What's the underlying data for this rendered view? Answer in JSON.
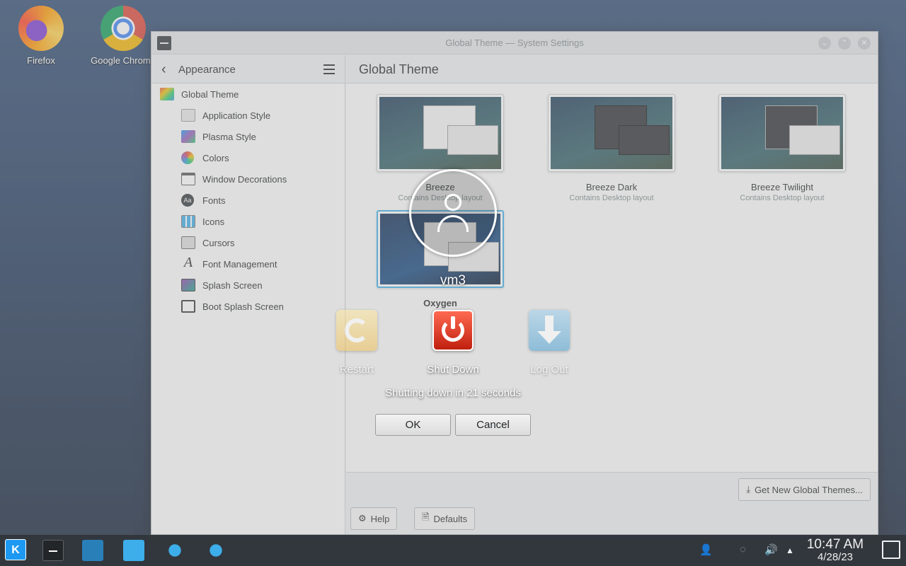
{
  "desktop": {
    "icons": [
      {
        "label": "Firefox"
      },
      {
        "label": "Google Chrome"
      }
    ]
  },
  "window": {
    "title": "Global Theme — System Settings",
    "sidebar": {
      "title": "Appearance",
      "items": [
        {
          "label": "Global Theme"
        },
        {
          "label": "Application Style"
        },
        {
          "label": "Plasma Style"
        },
        {
          "label": "Colors"
        },
        {
          "label": "Window Decorations"
        },
        {
          "label": "Fonts"
        },
        {
          "label": "Icons"
        },
        {
          "label": "Cursors"
        },
        {
          "label": "Font Management"
        },
        {
          "label": "Splash Screen"
        },
        {
          "label": "Boot Splash Screen"
        }
      ]
    },
    "main": {
      "title": "Global Theme",
      "themes": [
        {
          "name": "Breeze",
          "sub": "Contains Desktop layout"
        },
        {
          "name": "Breeze Dark",
          "sub": "Contains Desktop layout"
        },
        {
          "name": "Breeze Twilight",
          "sub": "Contains Desktop layout"
        },
        {
          "name": "Oxygen",
          "sub": ""
        }
      ],
      "get_new_label": "Get New Global Themes...",
      "help_label": "Help",
      "defaults_label": "Defaults"
    }
  },
  "logout_dialog": {
    "username": "vm3",
    "actions": [
      {
        "label": "Restart"
      },
      {
        "label": "Shut Down"
      },
      {
        "label": "Log Out"
      }
    ],
    "countdown": "Shutting down in 21 seconds",
    "ok_label": "OK",
    "cancel_label": "Cancel",
    "accent_color": "#d4260f"
  },
  "taskbar": {
    "time": "10:47 AM",
    "date": "4/28/23"
  },
  "colors": {
    "panel": "#31363b",
    "accent": "#3daee9"
  }
}
